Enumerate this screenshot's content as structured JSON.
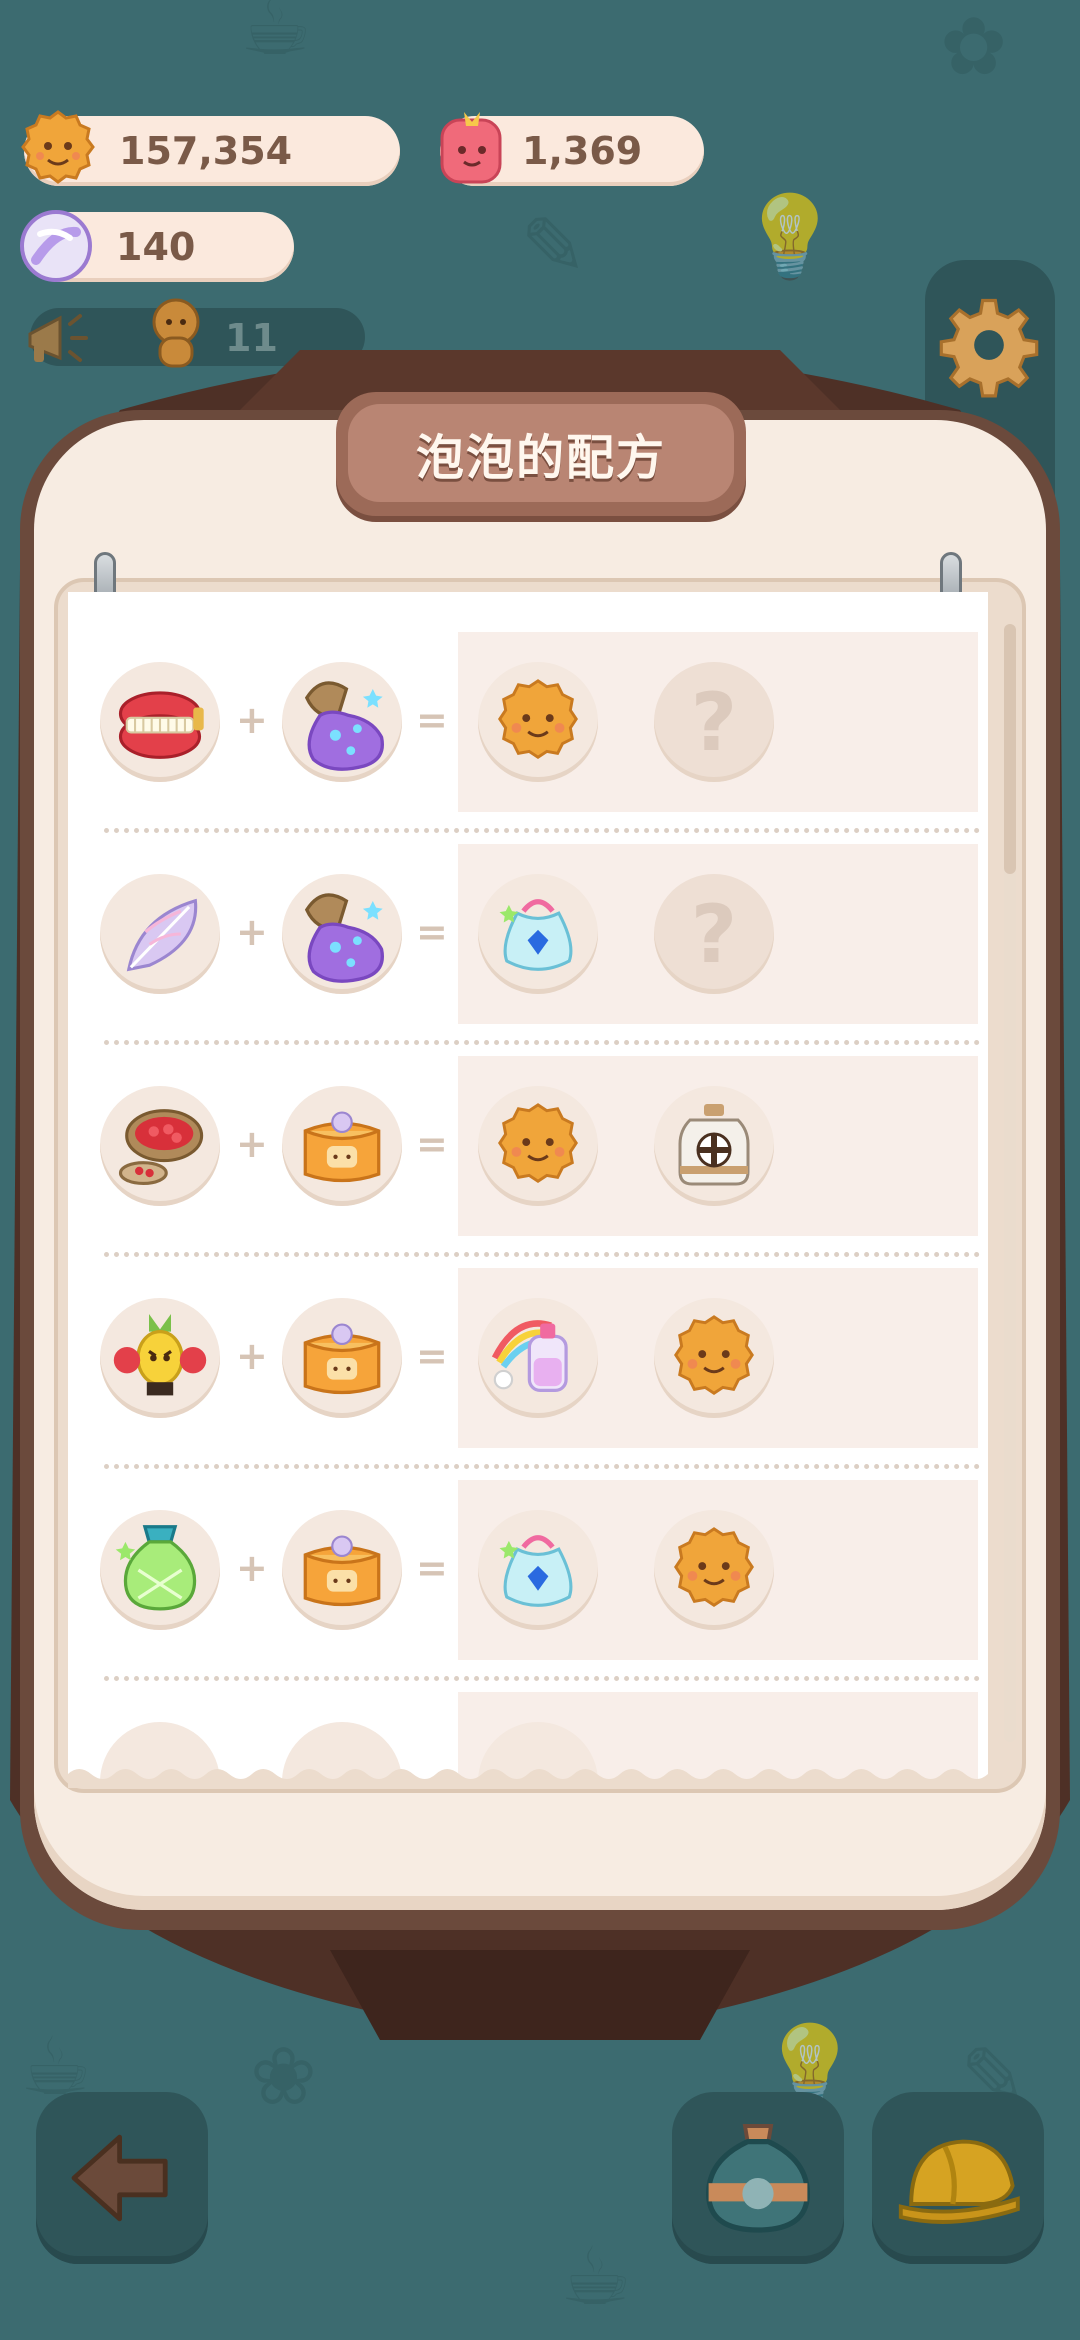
{
  "hud": {
    "coins": "157,354",
    "gems": "1,369",
    "candy": "140",
    "ad_reward": "11"
  },
  "icons": {
    "coin": "cookie-coin-icon",
    "gem": "pink-gem-icon",
    "candy": "candy-icon",
    "ad": "megaphone-icon",
    "ad_reward": "cookie-figure-icon",
    "settings": "gear-icon",
    "back": "arrow-left-icon",
    "potion": "potion-bottle-icon",
    "helmet": "helmet-icon"
  },
  "panel": {
    "title": "泡泡的配方"
  },
  "recipes": [
    {
      "a": "dentures",
      "b": "galaxy-sack",
      "r1": "cookie",
      "r2": "unknown"
    },
    {
      "a": "feather",
      "b": "galaxy-sack",
      "r1": "gem-bag",
      "r2": "unknown"
    },
    {
      "a": "bean-sack",
      "b": "bread-bag",
      "r1": "cookie",
      "r2": "milk-jar"
    },
    {
      "a": "angry-pineapple",
      "b": "bread-bag",
      "r1": "rainbow-bottle",
      "r2": "cookie"
    },
    {
      "a": "green-potion",
      "b": "bread-bag",
      "r1": "gem-bag",
      "r2": "cookie"
    }
  ],
  "operators": {
    "plus": "+",
    "equals": "="
  },
  "unknown_symbol": "?",
  "colors": {
    "background": "#3c6b70",
    "panel": "#f7ece2",
    "title_plate": "#9c6a58",
    "pill": "#fbe9dd"
  }
}
